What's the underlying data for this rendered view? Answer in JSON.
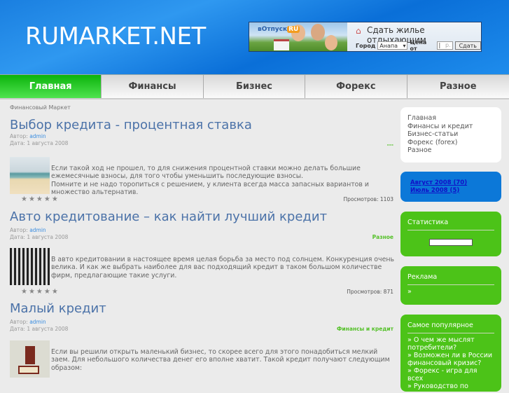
{
  "site": {
    "logo": "RUMARKET.NET"
  },
  "banner": {
    "brand": "вОтпуск",
    "brand_suffix": "RU",
    "title": "Сдать жилье отдыхающим",
    "city_label": "Город",
    "city_value": "Анапа",
    "price_label": "Цена от",
    "price_value": "|",
    "price_unit": "р.",
    "submit": "Сдать"
  },
  "nav": [
    "Главная",
    "Финансы",
    "Бизнес",
    "Форекс",
    "Разное"
  ],
  "breadcrumb": "Финансовый Маркет",
  "posts": [
    {
      "title": "Выбор кредита - процентная ставка",
      "author_label": "Автор:",
      "author": "admin",
      "date": "Дата: 1 августа 2008",
      "category": "---",
      "text": "Если такой ход не прошел, то для снижения процентной ставки можно делать большие ежемесячные взносы, для того чтобы уменьшить последующие взносы.",
      "text2": "Помните и не надо торопиться с решением, у клиента всегда масса запасных вариантов и множество альтернатив.",
      "rating": "★★★★★",
      "views": "Просмотров: 1103"
    },
    {
      "title": "Авто кредитование – как найти лучший кредит",
      "author_label": "Автор:",
      "author": "admin",
      "date": "Дата: 1 августа 2008",
      "category": "Разное",
      "text": "В авто кредитовании в настоящее время целая борьба за место под солнцем. Конкуренция очень велика. И как же выбрать наиболее для вас подходящий кредит в таком большом количестве фирм, предлагающие такие услуги.",
      "rating": "★★★★★",
      "views": "Просмотров: 871"
    },
    {
      "title": "Малый кредит",
      "author_label": "Автор:",
      "author": "admin",
      "date": "Дата: 1 августа 2008",
      "category": "Финансы и кредит",
      "text": "Если вы решили открыть маленький бизнес, то скорее всего для этого понадобиться мелкий заем. Для небольшого количества денег его вполне хватит. Такой кредит получают следующим образом:"
    }
  ],
  "sidebar": {
    "categories": [
      "Главная",
      "Финансы и кредит",
      "Бизнес-статьи",
      "Форекс (forex)",
      "Разное"
    ],
    "archives": [
      "Август 2008 (70)",
      "Июль 2008 (5)"
    ],
    "stats_title": "Статистика",
    "ads_title": "Реклама",
    "ads_item": "»",
    "popular_title": "Самое популярное",
    "popular": [
      "» О чем же мыслят потребители?",
      "» Возможен ли в России финансовый кризис?",
      "» Форекс - игра для всех",
      "» Руководство по"
    ]
  }
}
